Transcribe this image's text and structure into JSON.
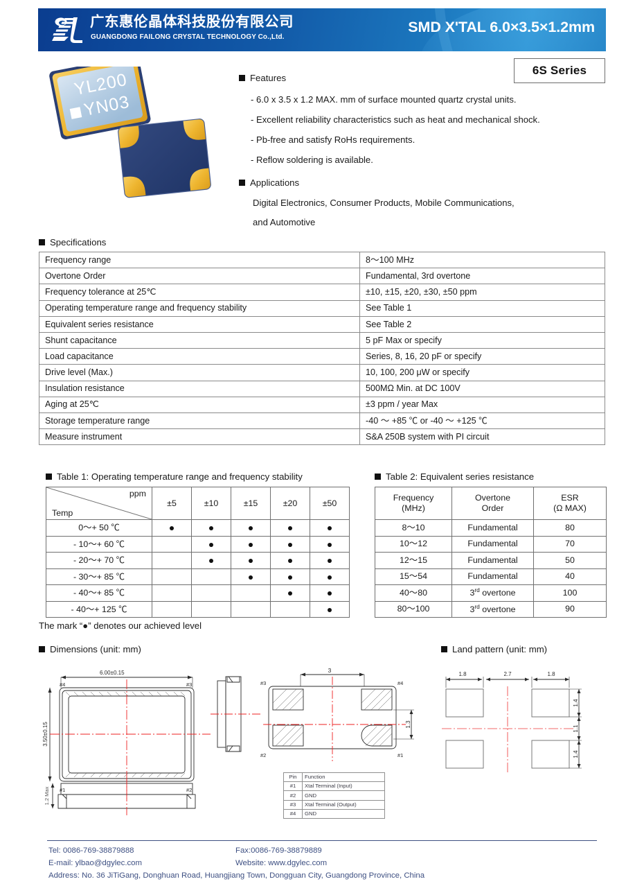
{
  "header": {
    "company_cn": "广东惠伦晶体科技股份有限公司",
    "company_en": "GUANGDONG FAILONG CRYSTAL TECHNOLOGY Co.,Ltd.",
    "title": "SMD X'TAL 6.0×3.5×1.2mm",
    "logo_name": "failong-logo",
    "banner_start_color": "#0b3d8f",
    "banner_end_color": "#2b93d4"
  },
  "series_badge": "6S Series",
  "product_photo": {
    "marking_line1": "YL200",
    "marking_line2": "YN03",
    "body_color": "#28407c",
    "pad_color": "#f0b93a",
    "lid_color": "#b9cfe4"
  },
  "features": {
    "heading": "Features",
    "items": [
      "- 6.0 x 3.5 x 1.2 MAX. mm of surface mounted quartz crystal units.",
      "- Excellent reliability characteristics such as heat and mechanical shock.",
      "- Pb-free and satisfy RoHs requirements.",
      "- Reflow soldering is available."
    ]
  },
  "applications": {
    "heading": "Applications",
    "lines": [
      "Digital Electronics, Consumer Products, Mobile Communications,",
      "and Automotive"
    ]
  },
  "specifications": {
    "heading": "Specifications",
    "rows": [
      {
        "key": "Frequency range",
        "value": "8～100 MHz"
      },
      {
        "key": "Overtone Order",
        "value": "Fundamental, 3rd overtone"
      },
      {
        "key": "Frequency tolerance at 25℃",
        "value": "±10, ±15, ±20, ±30, ±50 ppm"
      },
      {
        "key": "Operating temperature range and frequency stability",
        "value": "See Table 1"
      },
      {
        "key": "Equivalent series resistance",
        "value": "See Table 2"
      },
      {
        "key": "Shunt capacitance",
        "value": "5 pF Max or specify"
      },
      {
        "key": "Load capacitance",
        "value": "Series, 8, 16, 20 pF or specify"
      },
      {
        "key": "Drive level (Max.)",
        "value": "10, 100, 200 μW or specify"
      },
      {
        "key": "Insulation resistance",
        "value": "500MΩ Min. at DC 100V"
      },
      {
        "key": "Aging at 25℃",
        "value": "±3 ppm / year Max"
      },
      {
        "key": "Storage temperature range",
        "value": "-40 ～ +85 ℃ or -40 ～ +125 ℃"
      },
      {
        "key": "Measure instrument",
        "value": "S&A 250B system with PI circuit"
      }
    ]
  },
  "table1": {
    "heading": "Table 1: Operating temperature range and frequency stability",
    "corner_top": "ppm",
    "corner_bottom": "Temp",
    "columns": [
      "±5",
      "±10",
      "±15",
      "±20",
      "±50"
    ],
    "rows": [
      {
        "temp": "0～+ 50 ℃",
        "marks": [
          true,
          true,
          true,
          true,
          true
        ]
      },
      {
        "temp": "- 10～+ 60 ℃",
        "marks": [
          false,
          true,
          true,
          true,
          true
        ]
      },
      {
        "temp": "- 20～+ 70 ℃",
        "marks": [
          false,
          true,
          true,
          true,
          true
        ]
      },
      {
        "temp": "- 30～+ 85 ℃",
        "marks": [
          false,
          false,
          true,
          true,
          true
        ]
      },
      {
        "temp": "- 40～+ 85 ℃",
        "marks": [
          false,
          false,
          false,
          true,
          true
        ]
      },
      {
        "temp": "- 40～+ 125 ℃",
        "marks": [
          false,
          false,
          false,
          false,
          true
        ]
      }
    ]
  },
  "table2": {
    "heading": "Table 2: Equivalent series resistance",
    "headers": [
      {
        "l1": "Frequency",
        "l2": "(MHz)"
      },
      {
        "l1": "Overtone",
        "l2": "Order"
      },
      {
        "l1": "ESR",
        "l2": "(Ω MAX)"
      }
    ],
    "rows": [
      {
        "freq": "8～10",
        "order": "Fundamental",
        "order_sup": "",
        "esr": "80"
      },
      {
        "freq": "10～12",
        "order": "Fundamental",
        "order_sup": "",
        "esr": "70"
      },
      {
        "freq": "12～15",
        "order": "Fundamental",
        "order_sup": "",
        "esr": "50"
      },
      {
        "freq": "15～54",
        "order": "Fundamental",
        "order_sup": "",
        "esr": "40"
      },
      {
        "freq": "40～80",
        "order": "overtone",
        "order_sup": "3rd",
        "esr": "100"
      },
      {
        "freq": "80～100",
        "order": "overtone",
        "order_sup": "3rd",
        "esr": "90"
      }
    ]
  },
  "mark_note": "The mark “●” denotes our achieved level",
  "dimensions": {
    "heading": "Dimensions (unit: mm)",
    "top_view": {
      "width_dim": "6.00±0.15",
      "height_dim": "3.50±0.15",
      "pin_tl": "#4",
      "pin_tr": "#3",
      "pin_bl": "#1",
      "pin_br": "#2"
    },
    "side_view": {
      "height_dim": "1.2 Max"
    },
    "bottom_view": {
      "pad_span_dim": "3",
      "pad_height_dim": "1.3",
      "pin_tl": "#3",
      "pin_tr": "#4",
      "pin_bl": "#2",
      "pin_br": "#1"
    },
    "pin_table": {
      "headers": [
        "Pin",
        "Function"
      ],
      "rows": [
        {
          "pin": "#1",
          "fn": "Xtal Terminal (Input)"
        },
        {
          "pin": "#2",
          "fn": "GND"
        },
        {
          "pin": "#3",
          "fn": "Xtal Terminal (Output)"
        },
        {
          "pin": "#4",
          "fn": "GND"
        }
      ]
    }
  },
  "land_pattern": {
    "heading": "Land pattern (unit: mm)",
    "dim_left": "1.8",
    "dim_center": "2.7",
    "dim_right": "1.8",
    "dim_pad_top": "1.4",
    "dim_gap": "1.1",
    "dim_pad_bottom": "1.4"
  },
  "footer": {
    "tel": "Tel: 0086-769-38879888",
    "fax": "Fax:0086-769-38879889",
    "email": "E-mail: ylbao@dgylec.com",
    "website": "Website: www.dgylec.com",
    "address": "Address: No. 36 JiTiGang, Donghuan Road, Huangjiang Town, Dongguan City, Guangdong Province, China",
    "color": "#3d4f82"
  }
}
